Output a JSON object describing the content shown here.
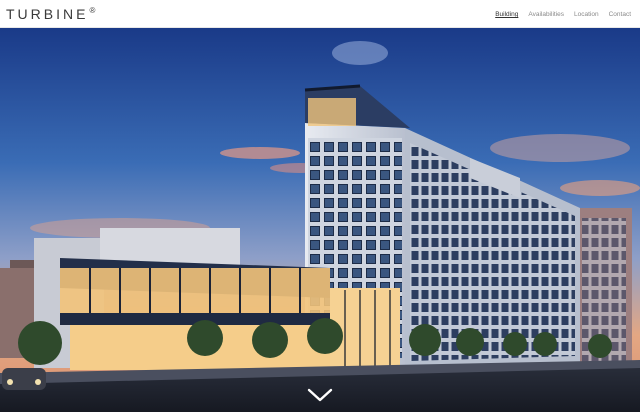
{
  "header": {
    "logo_text": "TURBINE",
    "logo_mark": "®"
  },
  "nav": {
    "items": [
      {
        "label": "Building",
        "active": true
      },
      {
        "label": "Availabilities",
        "active": false
      },
      {
        "label": "Location",
        "active": false
      },
      {
        "label": "Contact",
        "active": false
      }
    ]
  },
  "hero": {
    "image": "rendering of a multi-story loft office building at dusk",
    "scroll_icon": "chevron-down-icon"
  },
  "colors": {
    "sky_top": "#1d3f8c",
    "sky_bottom": "#e8a27a",
    "building": "#dfe3ea",
    "window_glow": "#f3c57a"
  }
}
